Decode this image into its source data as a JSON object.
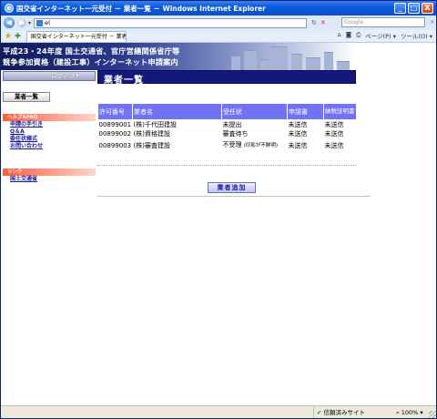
{
  "window": {
    "title": "国交省インターネット一元受付 － 業者一覧 － Windows Internet Explorer",
    "minimize": "_",
    "maximize": "□",
    "close": "X"
  },
  "address": {
    "url": "e(",
    "search_placeholder": "Google"
  },
  "tab": {
    "label": "国交省インターネット一元受付 － 業者一覧"
  },
  "toolbar": {
    "page_menu": "ページ(P) ▾",
    "tools_menu": "ツール(O) ▾"
  },
  "banner": {
    "line1": "平成23・24年度 国土交通省、官庁営繕関係省庁等",
    "line2": "競争参加資格（建設工事）インターネット申請案内"
  },
  "header": {
    "logout_label": "ログアウト",
    "page_title": "業者一覧"
  },
  "sidebar": {
    "current_section": "業者一覧",
    "help_header": "ヘルプ&FAQ",
    "help_links": [
      "申請の手引き",
      "Q＆A",
      "委任状様式",
      "お問い合わせ"
    ],
    "link_header": "リンク",
    "link_items": [
      "国土交通省"
    ]
  },
  "table": {
    "headers": [
      "許可番号",
      "業者名",
      "受任状",
      "申請書",
      "納税証明書"
    ],
    "rows": [
      {
        "permit_no": "00899001",
        "company": "(株)千代田建設",
        "status": "未提出",
        "status_note": "",
        "application": "未送信",
        "tax_cert": "未送信"
      },
      {
        "permit_no": "00899002",
        "company": "(株)資格建設",
        "status": "審査待ち",
        "status_note": "",
        "application": "未送信",
        "tax_cert": "未送信"
      },
      {
        "permit_no": "00899003",
        "company": "(株)審査建設",
        "status": "不受理",
        "status_note": "(印影が不鮮明)",
        "application": "未送信",
        "tax_cert": "未送信"
      }
    ]
  },
  "actions": {
    "add_label": "業者追加"
  },
  "status": {
    "zone": "信頼済みサイト",
    "zoom": "100%"
  }
}
